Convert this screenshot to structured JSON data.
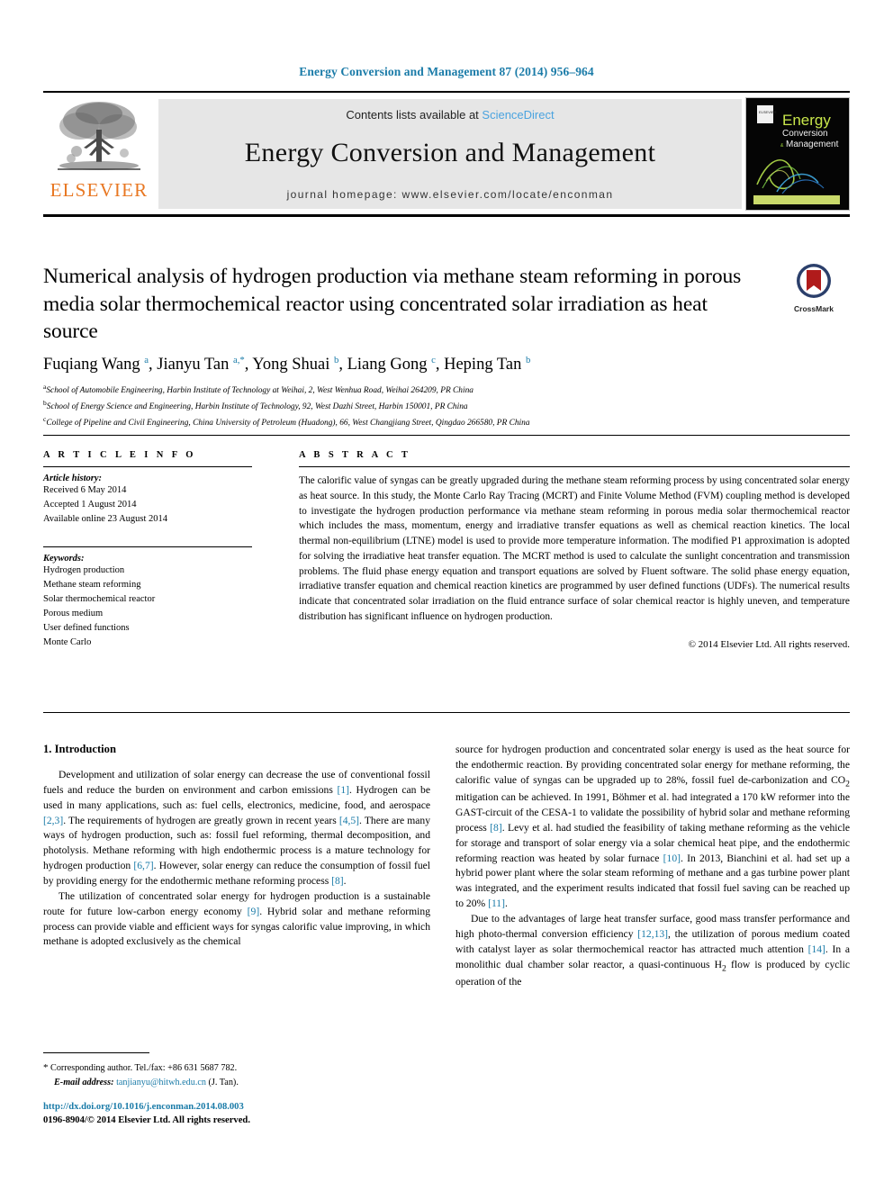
{
  "running_head": "Energy Conversion and Management 87 (2014) 956–964",
  "masthead": {
    "publisher_wordmark": "ELSEVIER",
    "contents_prefix": "Contents lists available at ",
    "contents_link": "ScienceDirect",
    "journal_name": "Energy Conversion and Management",
    "homepage": "journal homepage: www.elsevier.com/locate/enconman",
    "cover": {
      "line1": "Energy",
      "line2": "Conversion",
      "line3": "Management",
      "amp": "&"
    }
  },
  "crossmark": {
    "label": "CrossMark"
  },
  "article": {
    "title": "Numerical analysis of hydrogen production via methane steam reforming in porous media solar thermochemical reactor using concentrated solar irradiation as heat source",
    "authors_html": "Fuqiang Wang <sup>a</sup>, Jianyu Tan <sup>a,</sup><sup>*</sup>, Yong Shuai <sup>b</sup>, Liang Gong <sup>c</sup>, Heping Tan <sup>b</sup>",
    "affiliations": [
      {
        "marker": "a",
        "text": "School of Automobile Engineering, Harbin Institute of Technology at Weihai, 2, West Wenhua Road, Weihai 264209, PR China"
      },
      {
        "marker": "b",
        "text": "School of Energy Science and Engineering, Harbin Institute of Technology, 92, West Dazhi Street, Harbin 150001, PR China"
      },
      {
        "marker": "c",
        "text": "College of Pipeline and Civil Engineering, China University of Petroleum (Huadong), 66, West Changjiang Street, Qingdao 266580, PR China"
      }
    ]
  },
  "article_info": {
    "heading": "A R T I C L E   I N F O",
    "history_label": "Article history:",
    "history": [
      "Received 6 May 2014",
      "Accepted 1 August 2014",
      "Available online 23 August 2014"
    ],
    "keywords_label": "Keywords:",
    "keywords": [
      "Hydrogen production",
      "Methane steam reforming",
      "Solar thermochemical reactor",
      "Porous medium",
      "User defined functions",
      "Monte Carlo"
    ]
  },
  "abstract": {
    "heading": "A B S T R A C T",
    "text": "The calorific value of syngas can be greatly upgraded during the methane steam reforming process by using concentrated solar energy as heat source. In this study, the Monte Carlo Ray Tracing (MCRT) and Finite Volume Method (FVM) coupling method is developed to investigate the hydrogen production performance via methane steam reforming in porous media solar thermochemical reactor which includes the mass, momentum, energy and irradiative transfer equations as well as chemical reaction kinetics. The local thermal non-equilibrium (LTNE) model is used to provide more temperature information. The modified P1 approximation is adopted for solving the irradiative heat transfer equation. The MCRT method is used to calculate the sunlight concentration and transmission problems. The fluid phase energy equation and transport equations are solved by Fluent software. The solid phase energy equation, irradiative transfer equation and chemical reaction kinetics are programmed by user defined functions (UDFs). The numerical results indicate that concentrated solar irradiation on the fluid entrance surface of solar chemical reactor is highly uneven, and temperature distribution has significant influence on hydrogen production.",
    "copyright": "© 2014 Elsevier Ltd. All rights reserved."
  },
  "body": {
    "section_heading": "1. Introduction",
    "left_paragraphs_html": [
      "Development and utilization of solar energy can decrease the use of conventional fossil fuels and reduce the burden on environment and carbon emissions <span class=\"ref\">[1]</span>. Hydrogen can be used in many applications, such as: fuel cells, electronics, medicine, food, and aerospace <span class=\"ref\">[2,3]</span>. The requirements of hydrogen are greatly grown in recent years <span class=\"ref\">[4,5]</span>. There are many ways of hydrogen production, such as: fossil fuel reforming, thermal decomposition, and photolysis. Methane reforming with high endothermic process is a mature technology for hydrogen production <span class=\"ref\">[6,7]</span>. However, solar energy can reduce the consumption of fossil fuel by providing energy for the endothermic methane reforming process <span class=\"ref\">[8]</span>.",
      "The utilization of concentrated solar energy for hydrogen production is a sustainable route for future low-carbon energy economy <span class=\"ref\">[9]</span>. Hybrid solar and methane reforming process can provide viable and efficient ways for syngas calorific value improving, in which methane is adopted exclusively as the chemical"
    ],
    "right_paragraphs_html": [
      "source for hydrogen production and concentrated solar energy is used as the heat source for the endothermic reaction. By providing concentrated solar energy for methane reforming, the calorific value of syngas can be upgraded up to 28%, fossil fuel de-carbonization and CO<sub>2</sub> mitigation can be achieved. In 1991, Böhmer et al. had integrated a 170 kW reformer into the GAST-circuit of the CESA-1 to validate the possibility of hybrid solar and methane reforming process <span class=\"ref\">[8]</span>. Levy et al. had studied the feasibility of taking methane reforming as the vehicle for storage and transport of solar energy via a solar chemical heat pipe, and the endothermic reforming reaction was heated by solar furnace <span class=\"ref\">[10]</span>. In 2013, Bianchini et al. had set up a hybrid power plant where the solar steam reforming of methane and a gas turbine power plant was integrated, and the experiment results indicated that fossil fuel saving can be reached up to 20% <span class=\"ref\">[11]</span>.",
      "Due to the advantages of large heat transfer surface, good mass transfer performance and high photo-thermal conversion efficiency <span class=\"ref\">[12,13]</span>, the utilization of porous medium coated with catalyst layer as solar thermochemical reactor has attracted much attention <span class=\"ref\">[14]</span>. In a monolithic dual chamber solar reactor, a quasi-continuous H<sub>2</sub> flow is produced by cyclic operation of the"
    ]
  },
  "footnote": {
    "star": "*",
    "corresponding": "Corresponding author. Tel./fax: +86 631 5687 782.",
    "email_label": "E-mail address:",
    "email": "tanjianyu@hitwh.edu.cn",
    "email_suffix": "(J. Tan)."
  },
  "doi": {
    "url": "http://dx.doi.org/10.1016/j.enconman.2014.08.003",
    "issn": "0196-8904/© 2014 Elsevier Ltd. All rights reserved."
  },
  "colors": {
    "link": "#1a7ba8",
    "sciencedirect": "#4aa3df",
    "elsevier_orange": "#E87722",
    "band": "#e6e6e6"
  }
}
